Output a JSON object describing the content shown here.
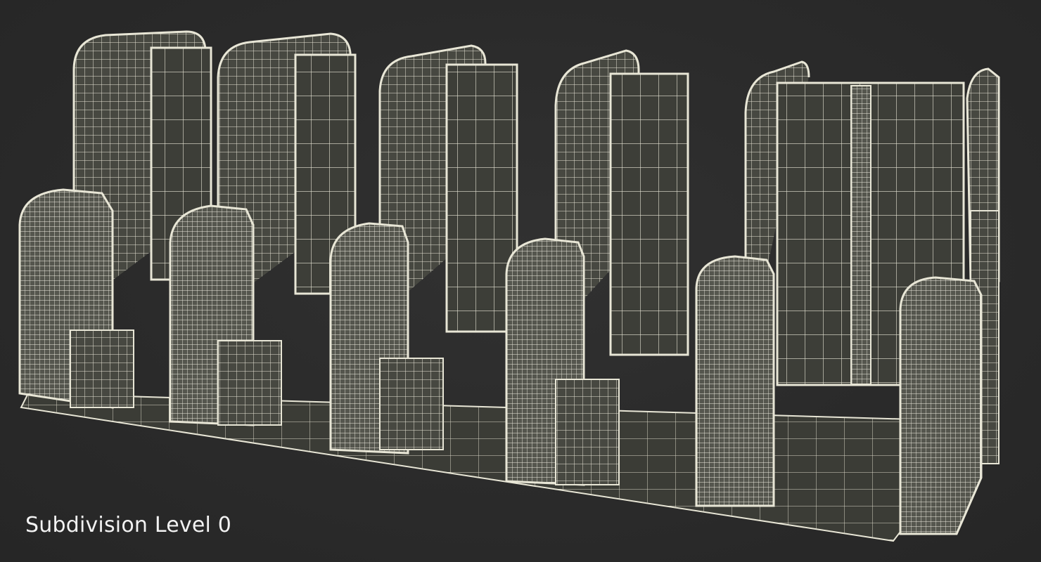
{
  "render": {
    "caption": "Subdivision Level 0",
    "subject": "turnstile-gates-wireframe",
    "colors": {
      "background": "#2b2b2b",
      "wire": "#e8e6d6",
      "fill_dark": "#3a3b36",
      "fill_mid": "#4a4b44",
      "caption_text": "#f2f2f2"
    }
  }
}
